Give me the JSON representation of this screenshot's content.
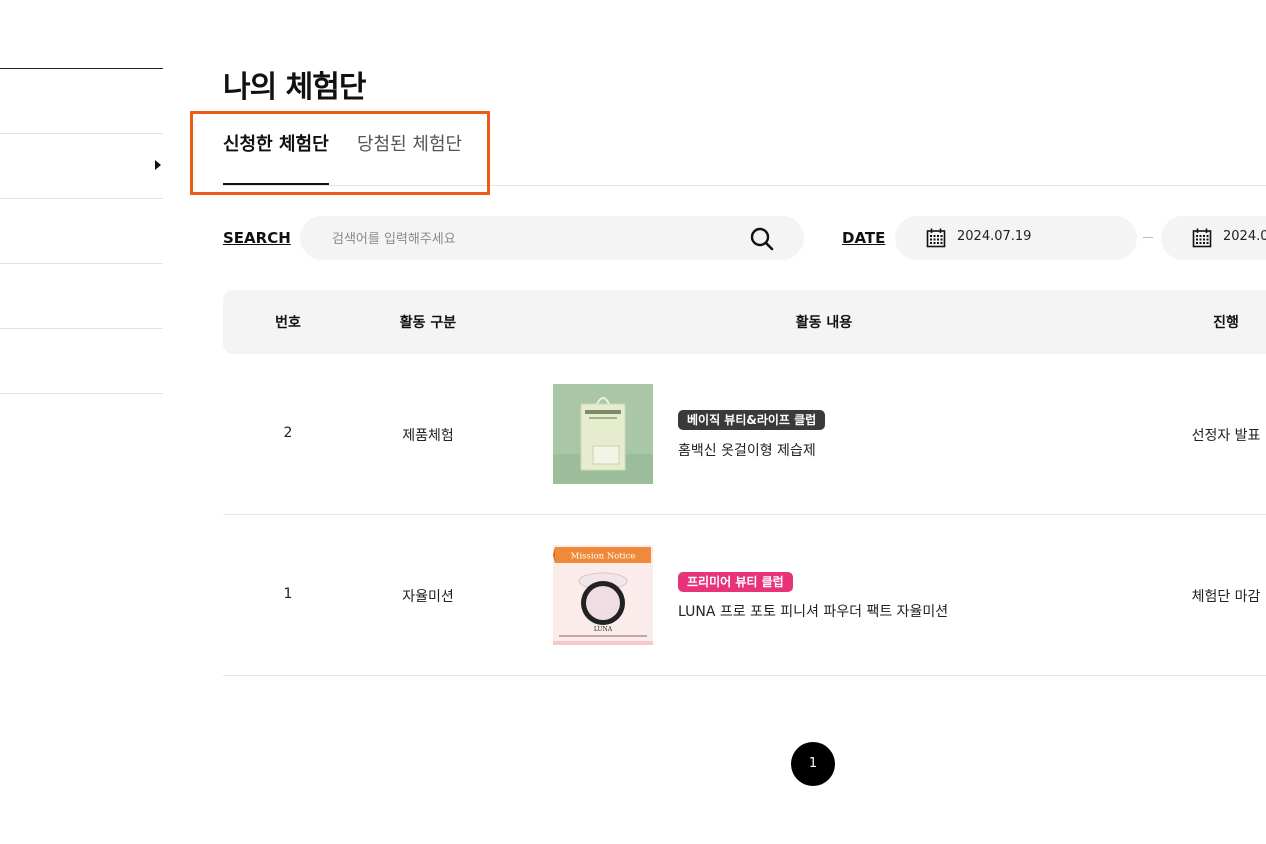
{
  "page": {
    "title": "나의 체험단"
  },
  "tabs": [
    {
      "label": "신청한 체험단",
      "active": true
    },
    {
      "label": "당첨된 체험단",
      "active": false
    }
  ],
  "search": {
    "label": "SEARCH",
    "placeholder": "검색어를 입력해주세요",
    "icon": "search-icon"
  },
  "date": {
    "label": "DATE",
    "from": "2024.07.19",
    "to": "2024.0",
    "icon": "calendar-icon"
  },
  "table": {
    "headers": [
      "번호",
      "활동 구분",
      "활동 내용",
      "진행"
    ],
    "rows": [
      {
        "number": "2",
        "category": "제품체험",
        "badge": "베이직 뷰티&라이프 클럽",
        "badge_color": "#3a3a3a",
        "title": "홈백신 옷걸이형 제습제",
        "status": "선정자 발표"
      },
      {
        "number": "1",
        "category": "자율미션",
        "badge": "프리미어 뷰티 클럽",
        "badge_color": "#e8337a",
        "title": "LUNA 프로 포토 피니셔 파우더 팩트 자율미션",
        "status": "체험단 마감",
        "thumb_banner": "Mission Notice",
        "thumb_brand": "LUNA"
      }
    ]
  },
  "pagination": {
    "current": "1"
  },
  "colors": {
    "highlight": "#ef5a1a",
    "accent_pink": "#e8337a",
    "dark_badge": "#3a3a3a"
  }
}
